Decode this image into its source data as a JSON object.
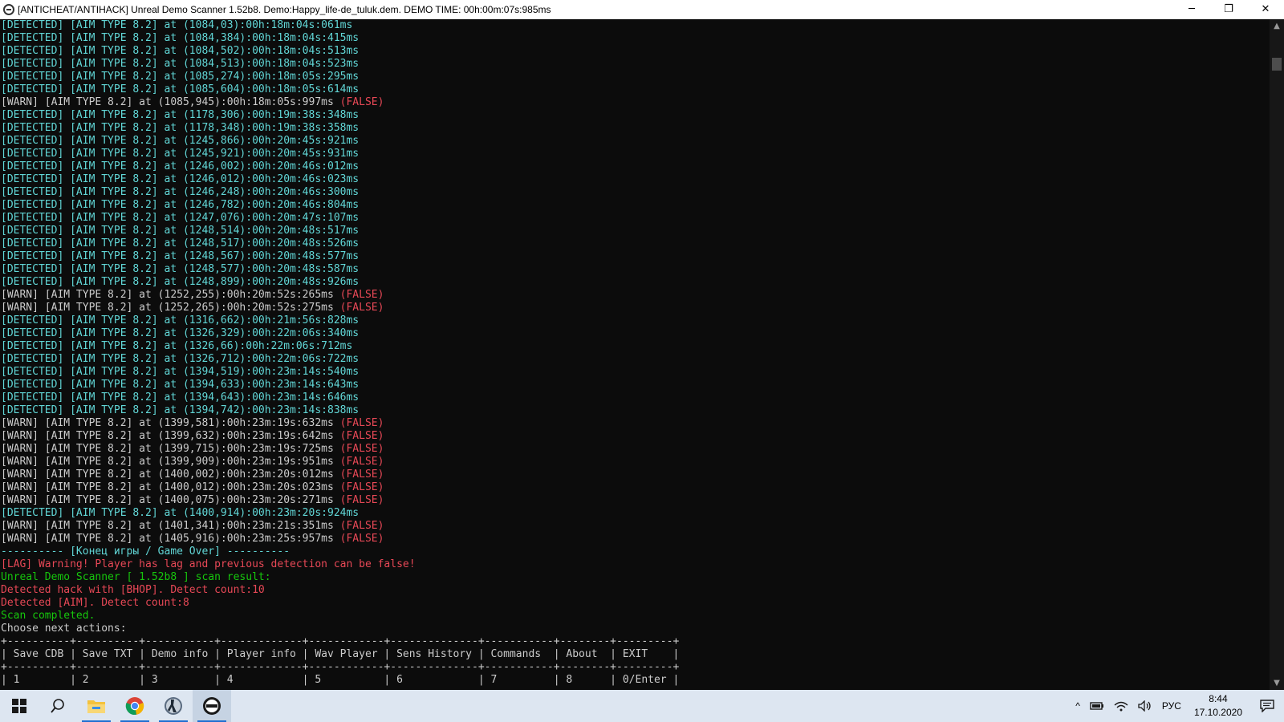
{
  "window": {
    "title": "[ANTICHEAT/ANTIHACK] Unreal Demo Scanner 1.52b8. Demo:Happy_life-de_tuluk.dem. DEMO TIME: 00h:00m:07s:985ms",
    "minimize_glyph": "─",
    "restore_glyph": "❐",
    "close_glyph": "✕"
  },
  "console": {
    "lines": [
      {
        "text": "[DETECTED] [AIM TYPE 8.2] at (1084,03):00h:18m:04s:061ms",
        "tag": "",
        "kind": "detected"
      },
      {
        "text": "[DETECTED] [AIM TYPE 8.2] at (1084,384):00h:18m:04s:415ms",
        "tag": "",
        "kind": "detected"
      },
      {
        "text": "[DETECTED] [AIM TYPE 8.2] at (1084,502):00h:18m:04s:513ms",
        "tag": "",
        "kind": "detected"
      },
      {
        "text": "[DETECTED] [AIM TYPE 8.2] at (1084,513):00h:18m:04s:523ms",
        "tag": "",
        "kind": "detected"
      },
      {
        "text": "[DETECTED] [AIM TYPE 8.2] at (1085,274):00h:18m:05s:295ms",
        "tag": "",
        "kind": "detected"
      },
      {
        "text": "[DETECTED] [AIM TYPE 8.2] at (1085,604):00h:18m:05s:614ms",
        "tag": "",
        "kind": "detected"
      },
      {
        "text": "[WARN] [AIM TYPE 8.2] at (1085,945):00h:18m:05s:997ms ",
        "tag": "(FALSE)",
        "kind": "warn"
      },
      {
        "text": "[DETECTED] [AIM TYPE 8.2] at (1178,306):00h:19m:38s:348ms",
        "tag": "",
        "kind": "detected"
      },
      {
        "text": "[DETECTED] [AIM TYPE 8.2] at (1178,348):00h:19m:38s:358ms",
        "tag": "",
        "kind": "detected"
      },
      {
        "text": "[DETECTED] [AIM TYPE 8.2] at (1245,866):00h:20m:45s:921ms",
        "tag": "",
        "kind": "detected"
      },
      {
        "text": "[DETECTED] [AIM TYPE 8.2] at (1245,921):00h:20m:45s:931ms",
        "tag": "",
        "kind": "detected"
      },
      {
        "text": "[DETECTED] [AIM TYPE 8.2] at (1246,002):00h:20m:46s:012ms",
        "tag": "",
        "kind": "detected"
      },
      {
        "text": "[DETECTED] [AIM TYPE 8.2] at (1246,012):00h:20m:46s:023ms",
        "tag": "",
        "kind": "detected"
      },
      {
        "text": "[DETECTED] [AIM TYPE 8.2] at (1246,248):00h:20m:46s:300ms",
        "tag": "",
        "kind": "detected"
      },
      {
        "text": "[DETECTED] [AIM TYPE 8.2] at (1246,782):00h:20m:46s:804ms",
        "tag": "",
        "kind": "detected"
      },
      {
        "text": "[DETECTED] [AIM TYPE 8.2] at (1247,076):00h:20m:47s:107ms",
        "tag": "",
        "kind": "detected"
      },
      {
        "text": "[DETECTED] [AIM TYPE 8.2] at (1248,514):00h:20m:48s:517ms",
        "tag": "",
        "kind": "detected"
      },
      {
        "text": "[DETECTED] [AIM TYPE 8.2] at (1248,517):00h:20m:48s:526ms",
        "tag": "",
        "kind": "detected"
      },
      {
        "text": "[DETECTED] [AIM TYPE 8.2] at (1248,567):00h:20m:48s:577ms",
        "tag": "",
        "kind": "detected"
      },
      {
        "text": "[DETECTED] [AIM TYPE 8.2] at (1248,577):00h:20m:48s:587ms",
        "tag": "",
        "kind": "detected"
      },
      {
        "text": "[DETECTED] [AIM TYPE 8.2] at (1248,899):00h:20m:48s:926ms",
        "tag": "",
        "kind": "detected"
      },
      {
        "text": "[WARN] [AIM TYPE 8.2] at (1252,255):00h:20m:52s:265ms ",
        "tag": "(FALSE)",
        "kind": "warn"
      },
      {
        "text": "[WARN] [AIM TYPE 8.2] at (1252,265):00h:20m:52s:275ms ",
        "tag": "(FALSE)",
        "kind": "warn"
      },
      {
        "text": "[DETECTED] [AIM TYPE 8.2] at (1316,662):00h:21m:56s:828ms",
        "tag": "",
        "kind": "detected"
      },
      {
        "text": "[DETECTED] [AIM TYPE 8.2] at (1326,329):00h:22m:06s:340ms",
        "tag": "",
        "kind": "detected"
      },
      {
        "text": "[DETECTED] [AIM TYPE 8.2] at (1326,66):00h:22m:06s:712ms",
        "tag": "",
        "kind": "detected"
      },
      {
        "text": "[DETECTED] [AIM TYPE 8.2] at (1326,712):00h:22m:06s:722ms",
        "tag": "",
        "kind": "detected"
      },
      {
        "text": "[DETECTED] [AIM TYPE 8.2] at (1394,519):00h:23m:14s:540ms",
        "tag": "",
        "kind": "detected"
      },
      {
        "text": "[DETECTED] [AIM TYPE 8.2] at (1394,633):00h:23m:14s:643ms",
        "tag": "",
        "kind": "detected"
      },
      {
        "text": "[DETECTED] [AIM TYPE 8.2] at (1394,643):00h:23m:14s:646ms",
        "tag": "",
        "kind": "detected"
      },
      {
        "text": "[DETECTED] [AIM TYPE 8.2] at (1394,742):00h:23m:14s:838ms",
        "tag": "",
        "kind": "detected"
      },
      {
        "text": "[WARN] [AIM TYPE 8.2] at (1399,581):00h:23m:19s:632ms ",
        "tag": "(FALSE)",
        "kind": "warn"
      },
      {
        "text": "[WARN] [AIM TYPE 8.2] at (1399,632):00h:23m:19s:642ms ",
        "tag": "(FALSE)",
        "kind": "warn"
      },
      {
        "text": "[WARN] [AIM TYPE 8.2] at (1399,715):00h:23m:19s:725ms ",
        "tag": "(FALSE)",
        "kind": "warn"
      },
      {
        "text": "[WARN] [AIM TYPE 8.2] at (1399,909):00h:23m:19s:951ms ",
        "tag": "(FALSE)",
        "kind": "warn"
      },
      {
        "text": "[WARN] [AIM TYPE 8.2] at (1400,002):00h:23m:20s:012ms ",
        "tag": "(FALSE)",
        "kind": "warn"
      },
      {
        "text": "[WARN] [AIM TYPE 8.2] at (1400,012):00h:23m:20s:023ms ",
        "tag": "(FALSE)",
        "kind": "warn"
      },
      {
        "text": "[WARN] [AIM TYPE 8.2] at (1400,075):00h:23m:20s:271ms ",
        "tag": "(FALSE)",
        "kind": "warn"
      },
      {
        "text": "[DETECTED] [AIM TYPE 8.2] at (1400,914):00h:23m:20s:924ms",
        "tag": "",
        "kind": "detected"
      },
      {
        "text": "[WARN] [AIM TYPE 8.2] at (1401,341):00h:23m:21s:351ms ",
        "tag": "(FALSE)",
        "kind": "warn"
      },
      {
        "text": "[WARN] [AIM TYPE 8.2] at (1405,916):00h:23m:25s:957ms ",
        "tag": "(FALSE)",
        "kind": "warn"
      },
      {
        "text": "---------- [Конец игры / Game Over] ----------",
        "tag": "",
        "kind": "gameover"
      },
      {
        "text": "[LAG] Warning! Player has lag and previous detection can be false!",
        "tag": "",
        "kind": "lag"
      },
      {
        "text": "Unreal Demo Scanner [ 1.52b8 ] scan result:",
        "tag": "",
        "kind": "result"
      },
      {
        "text": "Detected hack with [BHOP]. Detect count:10",
        "tag": "",
        "kind": "hack"
      },
      {
        "text": "Detected [AIM]. Detect count:8",
        "tag": "",
        "kind": "hack"
      },
      {
        "text": "Scan completed.",
        "tag": "",
        "kind": "result"
      },
      {
        "text": "Choose next actions:",
        "tag": "",
        "kind": "plain"
      }
    ],
    "menu_separator": "+----------+----------+-----------+-------------+------------+--------------+-----------+--------+---------+",
    "menu_labels": "| Save CDB | Save TXT | Demo info | Player info | Wav Player | Sens History | Commands  | About  | EXIT    |",
    "menu_keys": "| 1        | 2        | 3         | 4           | 5          | 6            | 7         | 8      | 0/Enter |"
  },
  "colors": {
    "detected": "#61d6d6",
    "warn": "#cccccc",
    "false_tag": "#e74856",
    "lag": "#e74856",
    "hack": "#e74856",
    "result": "#16c60c",
    "console_bg": "#0c0c0c",
    "taskbar_bg": "#dde6f1"
  },
  "scrollbar": {
    "up_glyph": "▲",
    "down_glyph": "▼"
  },
  "taskbar": {
    "apps": [
      {
        "name": "start-icon",
        "running": false
      },
      {
        "name": "search-icon",
        "running": false
      },
      {
        "name": "file-explorer-icon",
        "running": true
      },
      {
        "name": "chrome-icon",
        "running": true
      },
      {
        "name": "counter-strike-icon",
        "running": true
      },
      {
        "name": "demo-scanner-icon",
        "running": true,
        "active": true
      }
    ],
    "tray": {
      "chevron": "^",
      "language": "РУС",
      "time": "8:44",
      "date": "17.10.2020"
    }
  }
}
